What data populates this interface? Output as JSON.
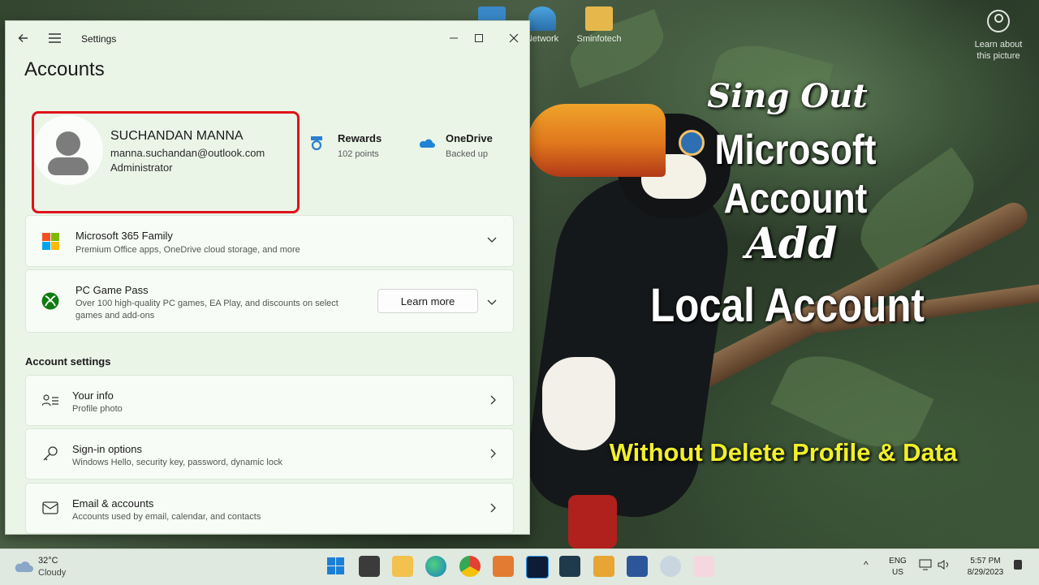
{
  "desktop": {
    "icons": [
      {
        "label": "Network"
      },
      {
        "label": "Sminfotech"
      }
    ],
    "learn_about": {
      "line1": "Learn about",
      "line2": "this picture"
    }
  },
  "overlay": {
    "line1": "Sing Out",
    "line2": "Microsoft Account",
    "line3": "Add",
    "line4": "Local Account",
    "line5": "Without Delete Profile & Data",
    "yellow": "#f1f02a"
  },
  "window": {
    "title": "Settings",
    "page_title": "Accounts",
    "profile": {
      "name": "SUCHANDAN MANNA",
      "email": "manna.suchandan@outlook.com",
      "role": "Administrator"
    },
    "rewards": {
      "title": "Rewards",
      "sub": "102 points"
    },
    "onedrive": {
      "title": "OneDrive",
      "sub": "Backed up"
    },
    "cards": {
      "m365": {
        "title": "Microsoft 365 Family",
        "sub": "Premium Office apps, OneDrive cloud storage, and more"
      },
      "gamepass": {
        "title": "PC Game Pass",
        "sub1": "Over 100 high-quality PC games, EA Play, and discounts on select",
        "sub2": "games and add-ons",
        "button": "Learn more"
      }
    },
    "section_title": "Account settings",
    "settings": [
      {
        "title": "Your info",
        "sub": "Profile photo"
      },
      {
        "title": "Sign-in options",
        "sub": "Windows Hello, security key, password, dynamic lock"
      },
      {
        "title": "Email & accounts",
        "sub": "Accounts used by email, calendar, and contacts"
      }
    ],
    "highlight_color": "#e0121b"
  },
  "taskbar": {
    "weather": {
      "temp": "32°C",
      "condition": "Cloudy"
    },
    "lang": {
      "line1": "ENG",
      "line2": "US"
    },
    "time": "5:57 PM",
    "date": "8/29/2023"
  }
}
